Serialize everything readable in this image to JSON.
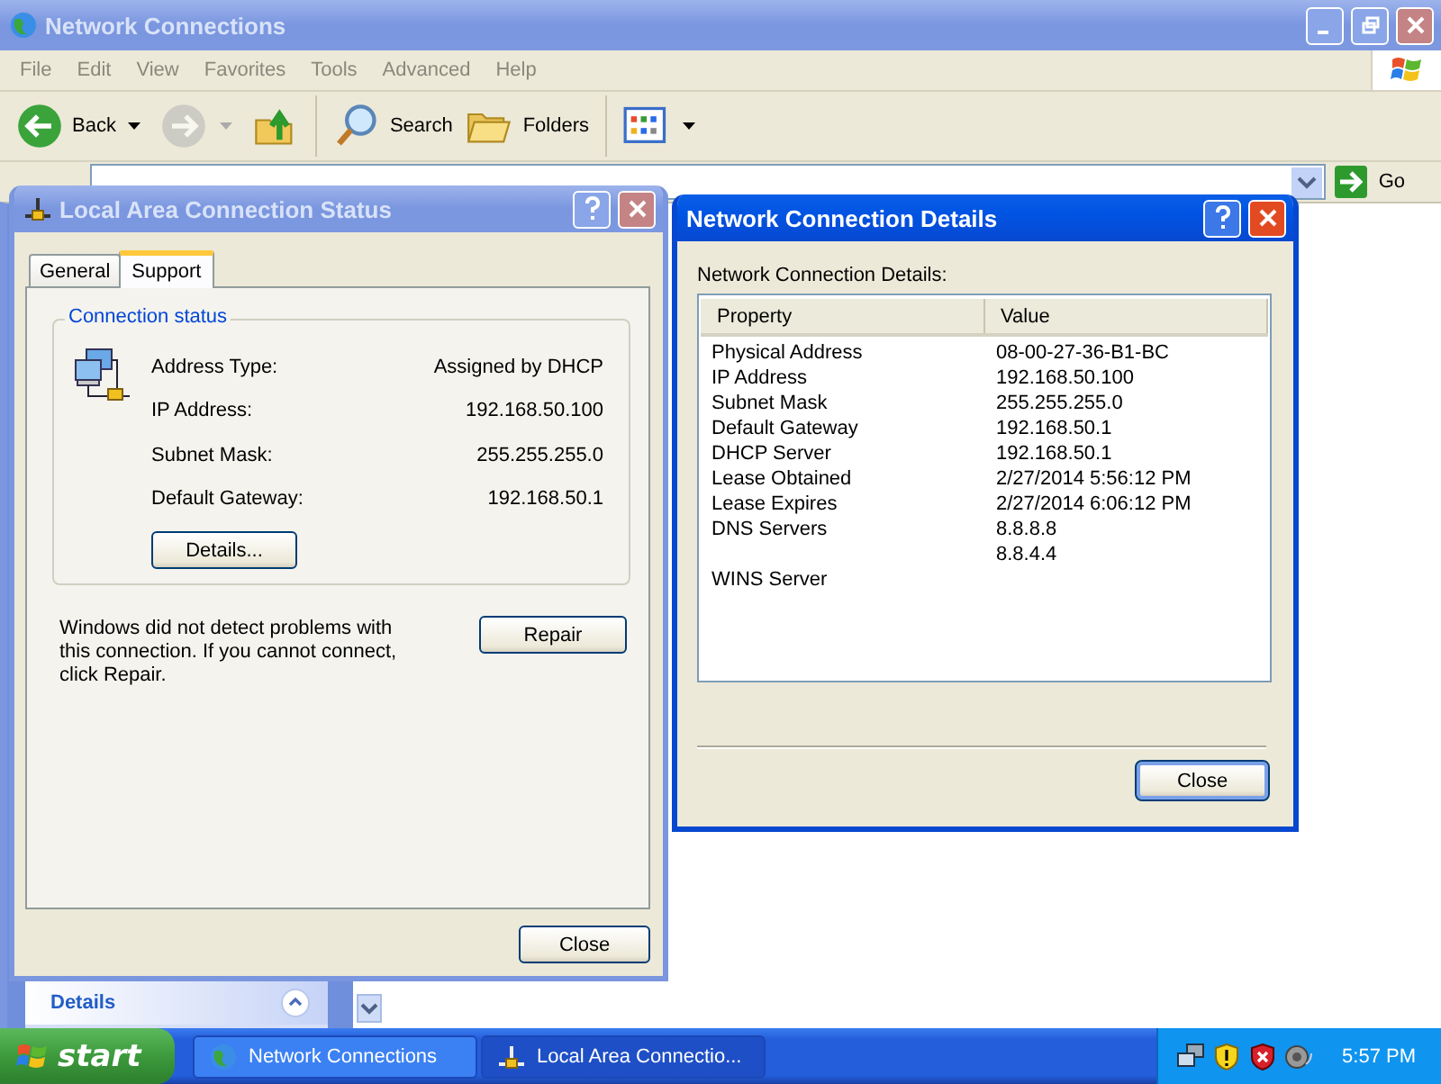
{
  "explorer": {
    "title": "Network Connections",
    "active": false,
    "menu": [
      "File",
      "Edit",
      "View",
      "Favorites",
      "Tools",
      "Advanced",
      "Help"
    ],
    "toolbar": [
      {
        "kind": "back",
        "label": "Back",
        "disabled": false
      },
      {
        "kind": "forward",
        "disabled": true
      },
      {
        "kind": "up",
        "disabled": false
      },
      {
        "kind": "search",
        "label": "Search",
        "disabled": false
      },
      {
        "kind": "folders",
        "label": "Folders",
        "disabled": false
      },
      {
        "kind": "views",
        "disabled": false
      }
    ],
    "go_label": "Go",
    "task_pane": {
      "heading": "Details"
    }
  },
  "status_dialog": {
    "title": "Local Area Connection Status",
    "active": false,
    "tabs": [
      {
        "label": "General",
        "selected": false
      },
      {
        "label": "Support",
        "selected": true
      }
    ],
    "group_title": "Connection status",
    "fields": [
      {
        "label": "Address Type:",
        "value": "Assigned by DHCP"
      },
      {
        "label": "IP Address:",
        "value": "192.168.50.100"
      },
      {
        "label": "Subnet Mask:",
        "value": "255.255.255.0"
      },
      {
        "label": "Default Gateway:",
        "value": "192.168.50.1"
      }
    ],
    "details_button": "Details...",
    "message": "Windows did not detect problems with this connection. If you cannot connect, click Repair.",
    "repair_button": "Repair",
    "close_button": "Close"
  },
  "details_dialog": {
    "title": "Network Connection Details",
    "active": true,
    "caption": "Network Connection Details:",
    "columns": [
      "Property",
      "Value"
    ],
    "rows": [
      {
        "property": "Physical Address",
        "value": "08-00-27-36-B1-BC"
      },
      {
        "property": "IP Address",
        "value": "192.168.50.100"
      },
      {
        "property": "Subnet Mask",
        "value": "255.255.255.0"
      },
      {
        "property": "Default Gateway",
        "value": "192.168.50.1"
      },
      {
        "property": "DHCP Server",
        "value": "192.168.50.1"
      },
      {
        "property": "Lease Obtained",
        "value": "2/27/2014 5:56:12 PM"
      },
      {
        "property": "Lease Expires",
        "value": "2/27/2014 6:06:12 PM"
      },
      {
        "property": "DNS Servers",
        "value": "8.8.8.8"
      },
      {
        "value": "8.8.4.4"
      },
      {
        "property": "WINS Server"
      }
    ],
    "close_button": "Close"
  },
  "taskbar": {
    "start": "start",
    "tasks": [
      {
        "kind": "globe",
        "label": "Network Connections",
        "selected": false
      },
      {
        "kind": "network",
        "label": "Local Area Connectio...",
        "selected": true
      }
    ],
    "clock": "5:57 PM"
  }
}
